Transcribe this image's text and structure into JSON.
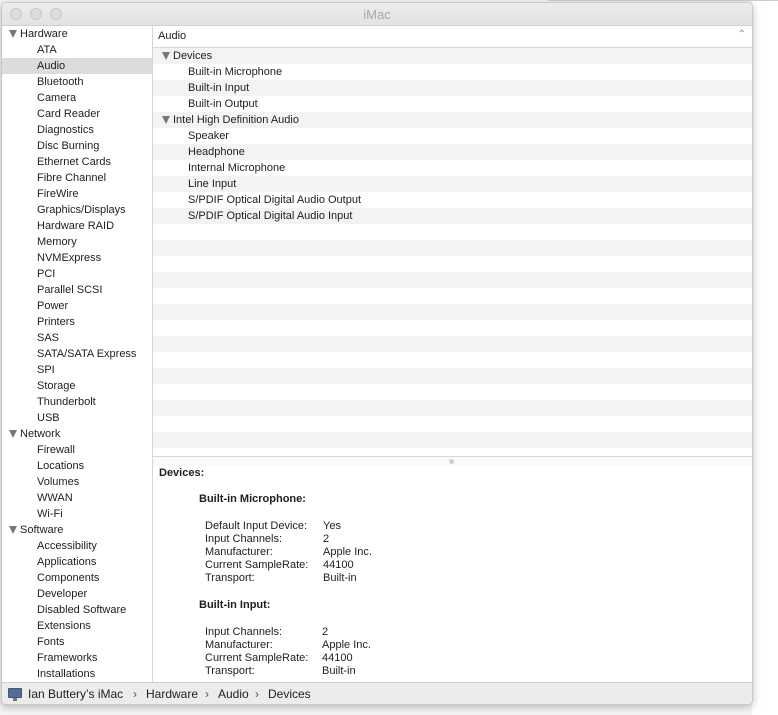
{
  "window": {
    "title": "iMac"
  },
  "sidebar": {
    "groups": [
      {
        "label": "Hardware",
        "items": [
          "ATA",
          "Audio",
          "Bluetooth",
          "Camera",
          "Card Reader",
          "Diagnostics",
          "Disc Burning",
          "Ethernet Cards",
          "Fibre Channel",
          "FireWire",
          "Graphics/Displays",
          "Hardware RAID",
          "Memory",
          "NVMExpress",
          "PCI",
          "Parallel SCSI",
          "Power",
          "Printers",
          "SAS",
          "SATA/SATA Express",
          "SPI",
          "Storage",
          "Thunderbolt",
          "USB"
        ]
      },
      {
        "label": "Network",
        "items": [
          "Firewall",
          "Locations",
          "Volumes",
          "WWAN",
          "Wi-Fi"
        ]
      },
      {
        "label": "Software",
        "items": [
          "Accessibility",
          "Applications",
          "Components",
          "Developer",
          "Disabled Software",
          "Extensions",
          "Fonts",
          "Frameworks",
          "Installations"
        ]
      }
    ],
    "selected": "Audio"
  },
  "table": {
    "header": "Audio",
    "groups": [
      {
        "label": "Devices",
        "children": [
          "Built-in Microphone",
          "Built-in Input",
          "Built-in Output"
        ]
      },
      {
        "label": "Intel High Definition Audio",
        "children": [
          "Speaker",
          "Headphone",
          "Internal Microphone",
          "Line Input",
          "S/PDIF Optical Digital Audio Output",
          "S/PDIF Optical Digital Audio Input"
        ]
      }
    ]
  },
  "detail": {
    "heading": "Devices:",
    "devices": [
      {
        "name": "Built-in Microphone:",
        "props": [
          {
            "key": "Default Input Device:",
            "value": "Yes"
          },
          {
            "key": "Input Channels:",
            "value": "2"
          },
          {
            "key": "Manufacturer:",
            "value": "Apple Inc."
          },
          {
            "key": "Current SampleRate:",
            "value": "44100"
          },
          {
            "key": "Transport:",
            "value": "Built-in"
          }
        ]
      },
      {
        "name": "Built-in Input:",
        "props": [
          {
            "key": "Input Channels:",
            "value": "2"
          },
          {
            "key": "Manufacturer:",
            "value": "Apple Inc."
          },
          {
            "key": "Current SampleRate:",
            "value": "44100"
          },
          {
            "key": "Transport:",
            "value": "Built-in"
          }
        ]
      }
    ]
  },
  "pathbar": {
    "crumbs": [
      "Ian Buttery’s iMac",
      "Hardware",
      "Audio",
      "Devices"
    ]
  }
}
